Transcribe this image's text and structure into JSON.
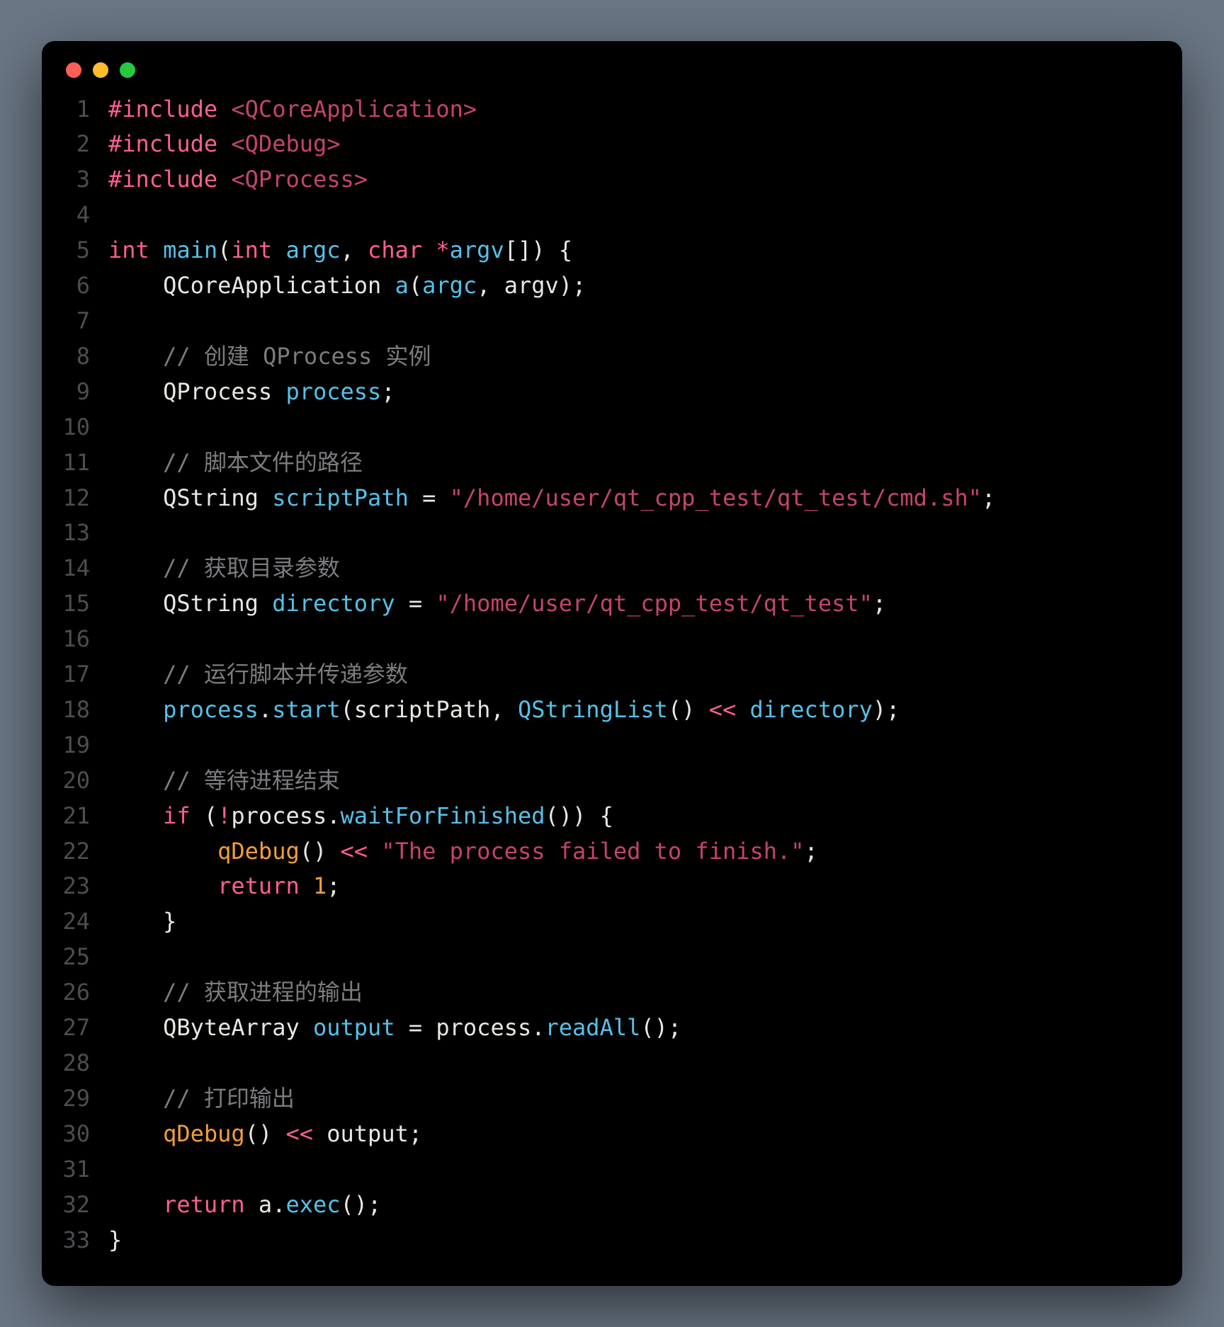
{
  "lines": [
    {
      "n": "1",
      "tokens": [
        [
          "pp",
          "#include"
        ],
        [
          "plain",
          " "
        ],
        [
          "inc",
          "<QCoreApplication>"
        ]
      ]
    },
    {
      "n": "2",
      "tokens": [
        [
          "pp",
          "#include"
        ],
        [
          "plain",
          " "
        ],
        [
          "inc",
          "<QDebug>"
        ]
      ]
    },
    {
      "n": "3",
      "tokens": [
        [
          "pp",
          "#include"
        ],
        [
          "plain",
          " "
        ],
        [
          "inc",
          "<QProcess>"
        ]
      ]
    },
    {
      "n": "4",
      "tokens": []
    },
    {
      "n": "5",
      "tokens": [
        [
          "kw",
          "int"
        ],
        [
          "plain",
          " "
        ],
        [
          "fn",
          "main"
        ],
        [
          "punc",
          "("
        ],
        [
          "kw",
          "int"
        ],
        [
          "plain",
          " "
        ],
        [
          "ident",
          "argc"
        ],
        [
          "punc",
          ", "
        ],
        [
          "kw",
          "char"
        ],
        [
          "plain",
          " "
        ],
        [
          "op",
          "*"
        ],
        [
          "ident",
          "argv"
        ],
        [
          "punc",
          "[]) {"
        ]
      ]
    },
    {
      "n": "6",
      "tokens": [
        [
          "plain",
          "    "
        ],
        [
          "type",
          "QCoreApplication "
        ],
        [
          "fn",
          "a"
        ],
        [
          "punc",
          "("
        ],
        [
          "ident",
          "argc"
        ],
        [
          "punc",
          ", "
        ],
        [
          "ident2",
          "argv"
        ],
        [
          "punc",
          ");"
        ]
      ]
    },
    {
      "n": "7",
      "tokens": []
    },
    {
      "n": "8",
      "tokens": [
        [
          "plain",
          "    "
        ],
        [
          "cmt",
          "// 创建 QProcess 实例"
        ]
      ]
    },
    {
      "n": "9",
      "tokens": [
        [
          "plain",
          "    "
        ],
        [
          "type",
          "QProcess "
        ],
        [
          "ident",
          "process"
        ],
        [
          "punc",
          ";"
        ]
      ]
    },
    {
      "n": "10",
      "tokens": []
    },
    {
      "n": "11",
      "tokens": [
        [
          "plain",
          "    "
        ],
        [
          "cmt",
          "// 脚本文件的路径"
        ]
      ]
    },
    {
      "n": "12",
      "tokens": [
        [
          "plain",
          "    "
        ],
        [
          "type",
          "QString "
        ],
        [
          "ident",
          "scriptPath"
        ],
        [
          "punc",
          " = "
        ],
        [
          "str",
          "\"/home/user/qt_cpp_test/qt_test/cmd.sh\""
        ],
        [
          "punc",
          ";"
        ]
      ]
    },
    {
      "n": "13",
      "tokens": []
    },
    {
      "n": "14",
      "tokens": [
        [
          "plain",
          "    "
        ],
        [
          "cmt",
          "// 获取目录参数"
        ]
      ]
    },
    {
      "n": "15",
      "tokens": [
        [
          "plain",
          "    "
        ],
        [
          "type",
          "QString "
        ],
        [
          "ident",
          "directory"
        ],
        [
          "punc",
          " = "
        ],
        [
          "str",
          "\"/home/user/qt_cpp_test/qt_test\""
        ],
        [
          "punc",
          ";"
        ]
      ]
    },
    {
      "n": "16",
      "tokens": []
    },
    {
      "n": "17",
      "tokens": [
        [
          "plain",
          "    "
        ],
        [
          "cmt",
          "// 运行脚本并传递参数"
        ]
      ]
    },
    {
      "n": "18",
      "tokens": [
        [
          "plain",
          "    "
        ],
        [
          "ident",
          "process"
        ],
        [
          "punc",
          "."
        ],
        [
          "fn",
          "start"
        ],
        [
          "punc",
          "("
        ],
        [
          "ident2",
          "scriptPath"
        ],
        [
          "punc",
          ", "
        ],
        [
          "fn",
          "QStringList"
        ],
        [
          "punc",
          "() "
        ],
        [
          "op",
          "<<"
        ],
        [
          "plain",
          " "
        ],
        [
          "ident",
          "directory"
        ],
        [
          "punc",
          ");"
        ]
      ]
    },
    {
      "n": "19",
      "tokens": []
    },
    {
      "n": "20",
      "tokens": [
        [
          "plain",
          "    "
        ],
        [
          "cmt",
          "// 等待进程结束"
        ]
      ]
    },
    {
      "n": "21",
      "tokens": [
        [
          "plain",
          "    "
        ],
        [
          "kw",
          "if"
        ],
        [
          "punc",
          " ("
        ],
        [
          "op",
          "!"
        ],
        [
          "ident2",
          "process"
        ],
        [
          "punc",
          "."
        ],
        [
          "fn",
          "waitForFinished"
        ],
        [
          "punc",
          "()) {"
        ]
      ]
    },
    {
      "n": "22",
      "tokens": [
        [
          "plain",
          "        "
        ],
        [
          "call",
          "qDebug"
        ],
        [
          "punc",
          "() "
        ],
        [
          "op",
          "<<"
        ],
        [
          "plain",
          " "
        ],
        [
          "str",
          "\"The process failed to finish.\""
        ],
        [
          "punc",
          ";"
        ]
      ]
    },
    {
      "n": "23",
      "tokens": [
        [
          "plain",
          "        "
        ],
        [
          "kw",
          "return"
        ],
        [
          "plain",
          " "
        ],
        [
          "num",
          "1"
        ],
        [
          "punc",
          ";"
        ]
      ]
    },
    {
      "n": "24",
      "tokens": [
        [
          "plain",
          "    "
        ],
        [
          "punc",
          "}"
        ]
      ]
    },
    {
      "n": "25",
      "tokens": []
    },
    {
      "n": "26",
      "tokens": [
        [
          "plain",
          "    "
        ],
        [
          "cmt",
          "// 获取进程的输出"
        ]
      ]
    },
    {
      "n": "27",
      "tokens": [
        [
          "plain",
          "    "
        ],
        [
          "type",
          "QByteArray "
        ],
        [
          "ident",
          "output"
        ],
        [
          "punc",
          " = "
        ],
        [
          "ident2",
          "process"
        ],
        [
          "punc",
          "."
        ],
        [
          "fn",
          "readAll"
        ],
        [
          "punc",
          "();"
        ]
      ]
    },
    {
      "n": "28",
      "tokens": []
    },
    {
      "n": "29",
      "tokens": [
        [
          "plain",
          "    "
        ],
        [
          "cmt",
          "// 打印输出"
        ]
      ]
    },
    {
      "n": "30",
      "tokens": [
        [
          "plain",
          "    "
        ],
        [
          "call",
          "qDebug"
        ],
        [
          "punc",
          "() "
        ],
        [
          "op",
          "<<"
        ],
        [
          "plain",
          " "
        ],
        [
          "ident2",
          "output"
        ],
        [
          "punc",
          ";"
        ]
      ]
    },
    {
      "n": "31",
      "tokens": []
    },
    {
      "n": "32",
      "tokens": [
        [
          "plain",
          "    "
        ],
        [
          "kw",
          "return"
        ],
        [
          "plain",
          " "
        ],
        [
          "ident2",
          "a"
        ],
        [
          "punc",
          "."
        ],
        [
          "fn",
          "exec"
        ],
        [
          "punc",
          "();"
        ]
      ]
    },
    {
      "n": "33",
      "tokens": [
        [
          "punc",
          "}"
        ]
      ]
    }
  ]
}
